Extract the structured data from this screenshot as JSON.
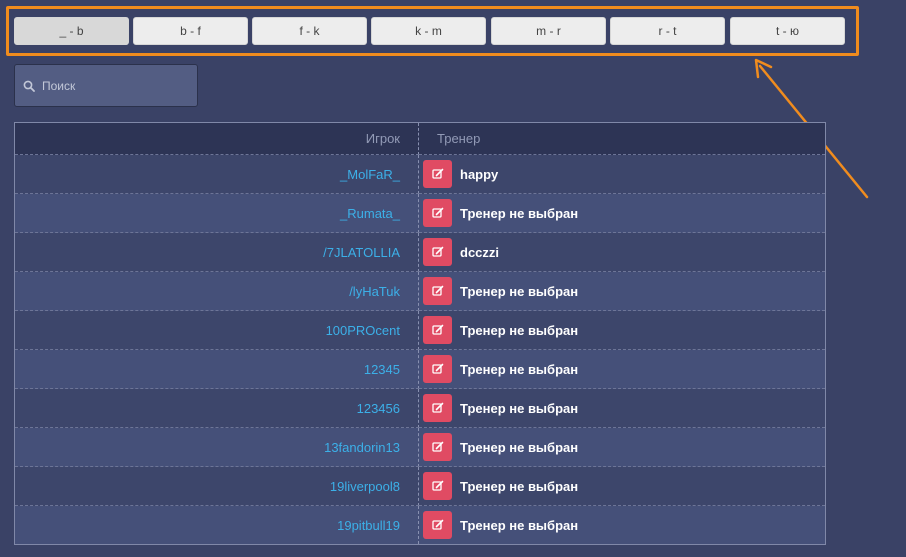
{
  "ranges": [
    {
      "label": "_ - b",
      "active": true
    },
    {
      "label": "b - f",
      "active": false
    },
    {
      "label": "f - k",
      "active": false
    },
    {
      "label": "k - m",
      "active": false
    },
    {
      "label": "m - r",
      "active": false
    },
    {
      "label": "r - t",
      "active": false
    },
    {
      "label": "t - ю",
      "active": false
    }
  ],
  "search": {
    "placeholder": "Поиск",
    "value": ""
  },
  "table": {
    "columns": {
      "player": "Игрок",
      "coach": "Тренер"
    },
    "rows": [
      {
        "player": "_MolFaR_",
        "coach": "happy"
      },
      {
        "player": "_Rumata_",
        "coach": "Тренер не выбран"
      },
      {
        "player": "/7JLATOLLIA",
        "coach": "dcczzi"
      },
      {
        "player": "/lyHaTuk",
        "coach": "Тренер не выбран"
      },
      {
        "player": "100PROcent",
        "coach": "Тренер не выбран"
      },
      {
        "player": "12345",
        "coach": "Тренер не выбран"
      },
      {
        "player": "123456",
        "coach": "Тренер не выбран"
      },
      {
        "player": "13fandorin13",
        "coach": "Тренер не выбран"
      },
      {
        "player": "19liverpool8",
        "coach": "Тренер не выбран"
      },
      {
        "player": "19pitbull19",
        "coach": "Тренер не выбран"
      }
    ]
  },
  "colors": {
    "background": "#3a4266",
    "highlight": "#f08c1e",
    "link": "#3cb0e8",
    "edit_button": "#e04b63"
  },
  "icons": {
    "search": "search-icon",
    "edit": "edit-icon",
    "annotation": "arrow-icon"
  }
}
